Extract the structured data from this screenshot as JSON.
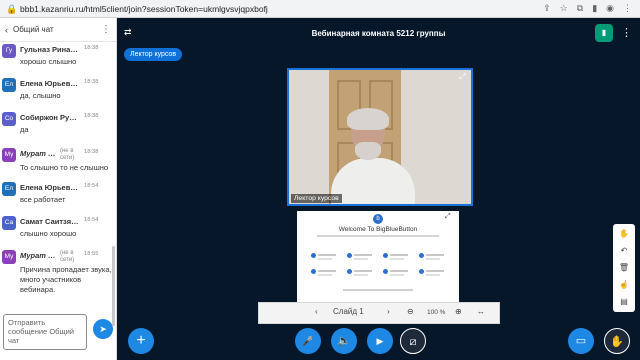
{
  "browser": {
    "url": "bbb1.kazanriu.ru/html5client/join?sessionToken=ukmlgvsvjqpxbofj"
  },
  "chat": {
    "title": "Общий чат",
    "input_placeholder": "Отправить сообщение Общий чат",
    "messages": [
      {
        "initials": "Гу",
        "name": "Гульназ Рина…",
        "time": "18:38",
        "text": "хорошо слышно",
        "color": "#6b57c5",
        "offline": false
      },
      {
        "initials": "Ел",
        "name": "Елена Юрьев…",
        "time": "18:38",
        "text": "да, слышно",
        "color": "#1f6fb9",
        "offline": false
      },
      {
        "initials": "Со",
        "name": "Собиржон Ру…",
        "time": "18:38",
        "text": "да",
        "color": "#5b5fc7",
        "offline": false
      },
      {
        "initials": "Му",
        "name": "Мурат …",
        "time": "18:38",
        "text": "То слышно то не слышно",
        "color": "#8b40b5",
        "offline": true,
        "status": "(не в сети)"
      },
      {
        "initials": "Ел",
        "name": "Елена Юрьев…",
        "time": "18:54",
        "text": "все работает",
        "color": "#1f6fb9",
        "offline": false
      },
      {
        "initials": "Са",
        "name": "Самат Саитзя…",
        "time": "18:54",
        "text": "слышно хорошо",
        "color": "#4b63c6",
        "offline": false
      },
      {
        "initials": "Му",
        "name": "Мурат …",
        "time": "18:55",
        "text": "Причина пропадает звука, много участников вебинара.",
        "color": "#8b40b5",
        "offline": true,
        "status": "(не в сети)"
      }
    ]
  },
  "room": {
    "title": "Вебинарная комната 5212 группы",
    "presenter_tag": "Лектор курсов",
    "video_name": "Лектор курсов"
  },
  "slide": {
    "welcome": "Welcome To BigBlueButton",
    "logo_letter": "b"
  },
  "slide_controls": {
    "prev": "‹",
    "label": "Слайд 1",
    "next": "›",
    "zoom_out": "⊖",
    "zoom": "100 %",
    "zoom_in": "⊕",
    "fit": "↔"
  },
  "icons": {
    "users": "⇄",
    "more": "⋮",
    "plus": "+",
    "mic": "🎤",
    "audio": "🔈",
    "camera": "▶",
    "screenshare": "⧄",
    "layout": "▭",
    "hand": "✋",
    "send": "➤",
    "back": "‹"
  },
  "colors": {
    "accent": "#1e88e5",
    "bg_main": "#06172a",
    "connection": "#009b77"
  }
}
